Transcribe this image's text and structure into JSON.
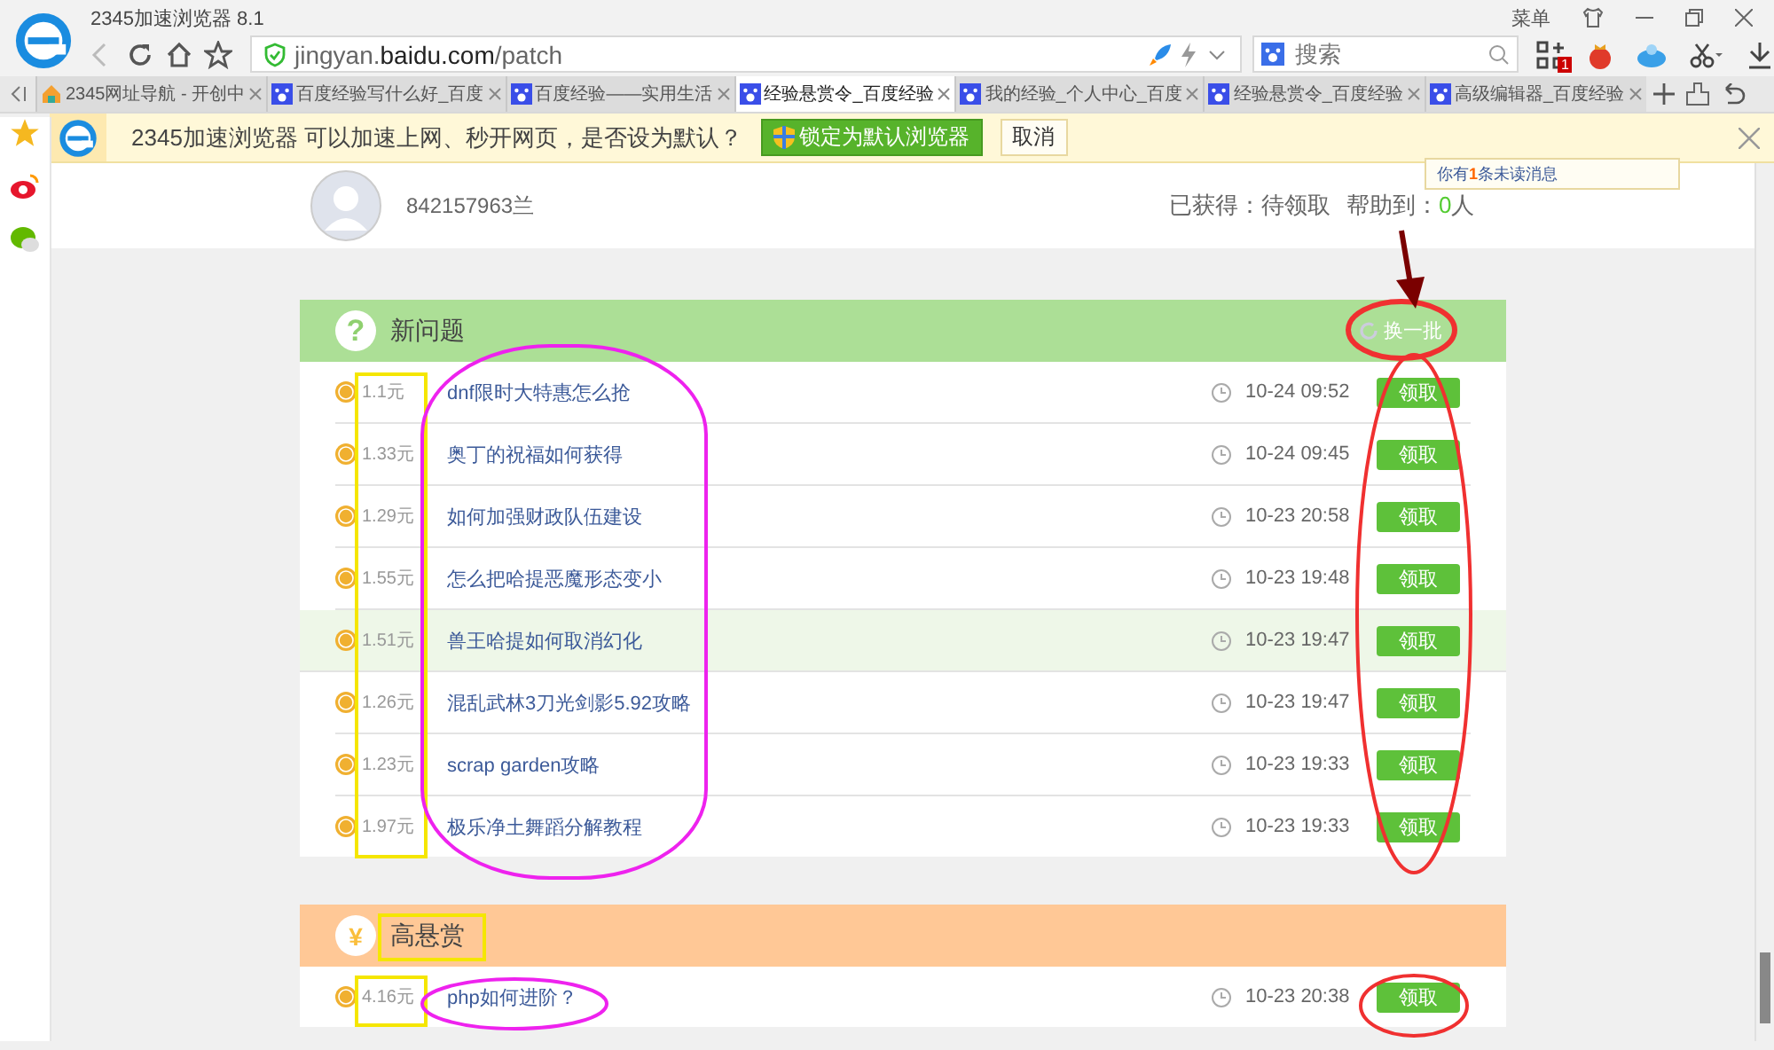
{
  "browser": {
    "title": "2345加速浏览器 8.1",
    "menu_label": "菜单",
    "url": "jingyan.**baidu.com**/patch",
    "search_placeholder": "搜索",
    "gift_badge": "1"
  },
  "tabs": [
    {
      "label": "2345网址导航 - 开创中",
      "selected": false
    },
    {
      "label": "百度经验写什么好_百度",
      "selected": false
    },
    {
      "label": "百度经验——实用生活",
      "selected": false
    },
    {
      "label": "经验悬赏令_百度经验",
      "selected": true
    },
    {
      "label": "我的经验_个人中心_百度",
      "selected": false
    },
    {
      "label": "经验悬赏令_百度经验",
      "selected": false
    },
    {
      "label": "高级编辑器_百度经验",
      "selected": false
    }
  ],
  "notice": {
    "text": "2345加速浏览器 可以加速上网、秒开网页，是否设为默认？",
    "primary_button": "锁定为默认浏览器",
    "cancel_button": "取消"
  },
  "profile": {
    "username": "842157963兰",
    "earned": "已获得：待领取",
    "helped_label": "帮助到：",
    "helped_count": "0",
    "helped_unit": "人"
  },
  "tooltip": "你有**1**条未读消息",
  "sections": [
    {
      "kind": "new",
      "icon": "?",
      "title": "新问题",
      "refresh": "换一批",
      "rows": [
        {
          "reward": "1.1元",
          "title": "dnf限时大特惠怎么抢",
          "time": "10-24 09:52",
          "button": "领取",
          "highlighted": false
        },
        {
          "reward": "1.33元",
          "title": "奥丁的祝福如何获得",
          "time": "10-24 09:45",
          "button": "领取",
          "highlighted": false
        },
        {
          "reward": "1.29元",
          "title": "如何加强财政队伍建设",
          "time": "10-23 20:58",
          "button": "领取",
          "highlighted": false
        },
        {
          "reward": "1.55元",
          "title": "怎么把哈提恶魔形态变小",
          "time": "10-23 19:48",
          "button": "领取",
          "highlighted": false
        },
        {
          "reward": "1.51元",
          "title": "兽王哈提如何取消幻化",
          "time": "10-23 19:47",
          "button": "领取",
          "highlighted": true
        },
        {
          "reward": "1.26元",
          "title": "混乱武林3刀光剑影5.92攻略",
          "time": "10-23 19:47",
          "button": "领取",
          "highlighted": false
        },
        {
          "reward": "1.23元",
          "title": "scrap garden攻略",
          "time": "10-23 19:33",
          "button": "领取",
          "highlighted": false
        },
        {
          "reward": "1.97元",
          "title": "极乐净土舞蹈分解教程",
          "time": "10-23 19:33",
          "button": "领取",
          "highlighted": false
        }
      ]
    },
    {
      "kind": "high",
      "icon": "¥",
      "title": "高悬赏",
      "rows": [
        {
          "reward": "4.16元",
          "title": "php如何进阶？",
          "time": "10-23 20:38",
          "button": "领取",
          "highlighted": false
        }
      ]
    }
  ]
}
